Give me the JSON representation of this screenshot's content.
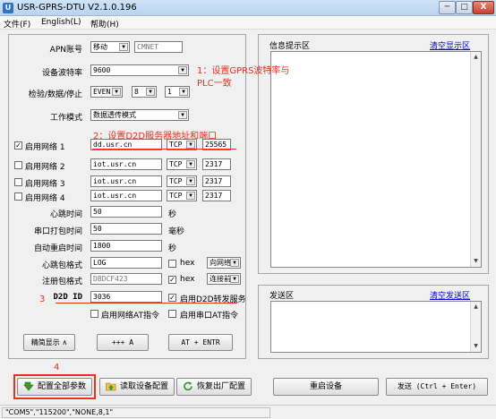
{
  "window": {
    "title": "USR-GPRS-DTU V2.1.0.196",
    "min_label": "─",
    "max_label": "□",
    "close_label": "X"
  },
  "menu": [
    "文件(F)",
    "English(L)",
    "帮助(H)"
  ],
  "config": {
    "apn_label": "APN账号",
    "apn_select": "移动",
    "apn_value": "CMNET",
    "baud_label": "设备波特率",
    "baud_value": "9600",
    "parity_label": "检验/数据/停止",
    "parity_value": "EVEN",
    "data_bits": "8",
    "stop_bits": "1",
    "mode_label": "工作模式",
    "mode_value": "数据透传模式"
  },
  "networks": [
    {
      "label": "启用网络  1",
      "checked": "✓",
      "address": "dd.usr.cn",
      "protocol": "TCP",
      "port": "25565"
    },
    {
      "label": "启用网络  2",
      "checked": "",
      "address": "iot.usr.cn",
      "protocol": "TCP",
      "port": "2317"
    },
    {
      "label": "启用网络  3",
      "checked": "",
      "address": "iot.usr.cn",
      "protocol": "TCP",
      "port": "2317"
    },
    {
      "label": "启用网络  4",
      "checked": "",
      "address": "iot.usr.cn",
      "protocol": "TCP",
      "port": "2317"
    }
  ],
  "params": {
    "heartbeat_label": "心跳时间",
    "heartbeat_value": "50",
    "heartbeat_unit": "秒",
    "pack_label": "串口打包时间",
    "pack_value": "50",
    "pack_unit": "毫秒",
    "restart_label": "自动重启时间",
    "restart_value": "1800",
    "restart_unit": "秒",
    "hb_format_label": "心跳包格式",
    "hb_format_value": "LOG",
    "hb_hex_label": "hex",
    "hb_dir_value": "向网络",
    "reg_format_label": "注册包格式",
    "reg_format_value": "DBDCF423",
    "reg_hex_label": "hex",
    "reg_dir_value": "连接前",
    "d2d_label": "D2D ID",
    "d2d_value": "3036",
    "d2d_forward_label": "启用D2D转发服务",
    "net_at_label": "启用网络AT指令",
    "serial_at_label": "启用串口AT指令"
  },
  "lower_buttons": {
    "simple_display": "精简显示 ∧",
    "plus": "+++ A",
    "at_enter": "AT + ENTR"
  },
  "info_panel": {
    "title": "信息提示区",
    "clear_link": "清空显示区"
  },
  "send_panel": {
    "title": "发送区",
    "clear_link": "清空发送区"
  },
  "bottom_buttons": {
    "config_all": "配置全部参数",
    "read_config": "读取设备配置",
    "restore": "恢复出厂配置",
    "restart": "重启设备",
    "send": "发送 (Ctrl + Enter)"
  },
  "annotations": {
    "note1_line1": "1：设置GPRS波特率与",
    "note1_line2": "PLC一致",
    "note2": "2：设置D2D服务器地址和端口",
    "note3": "3",
    "note4": "4"
  },
  "status": {
    "text": "\"COM5\",\"115200\",\"NONE,8,1\""
  },
  "colors": {
    "annotation": "#e8301c",
    "link": "#0000ee"
  }
}
